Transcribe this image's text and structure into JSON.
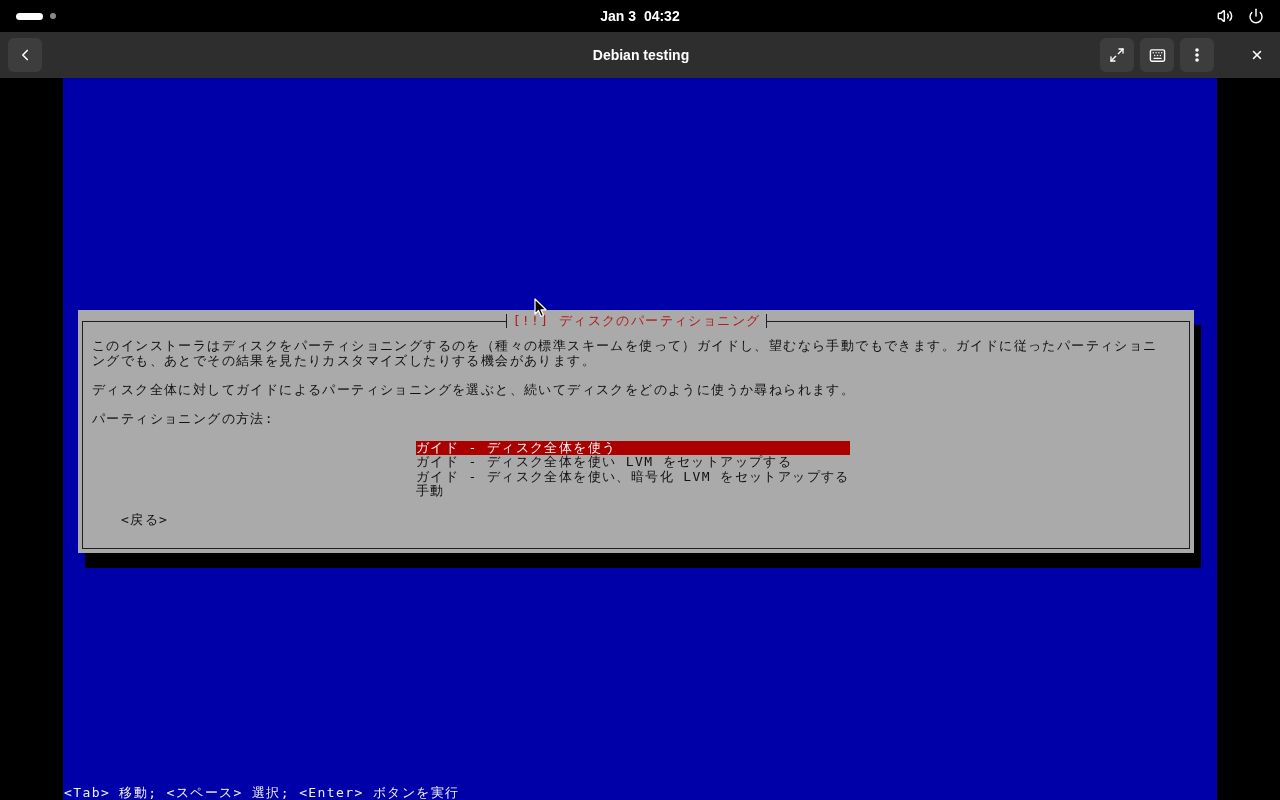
{
  "top_bar": {
    "clock": "Jan 3  04:32"
  },
  "window": {
    "title": "Debian testing"
  },
  "installer": {
    "dialog": {
      "title": "[!!] ディスクのパーティショニング",
      "paragraphs": [
        "このインストーラはディスクをパーティショニングするのを（種々の標準スキームを使って）ガイドし、望むなら手動でもできます。ガイドに従ったパーティショニングでも、あとでその結果を見たりカスタマイズしたりする機会があります。",
        "ディスク全体に対してガイドによるパーティショニングを選ぶと、続いてディスクをどのように使うか尋ねられます。"
      ],
      "prompt": "パーティショニングの方法:",
      "options": [
        {
          "label": "ガイド - ディスク全体を使う",
          "selected": true
        },
        {
          "label": "ガイド - ディスク全体を使い LVM をセットアップする",
          "selected": false
        },
        {
          "label": "ガイド - ディスク全体を使い、暗号化 LVM をセットアップする",
          "selected": false
        },
        {
          "label": "手動",
          "selected": false
        }
      ],
      "back_button": "<戻る>"
    },
    "help_line": "<Tab> 移動; <スペース> 選択; <Enter> ボタンを実行"
  }
}
